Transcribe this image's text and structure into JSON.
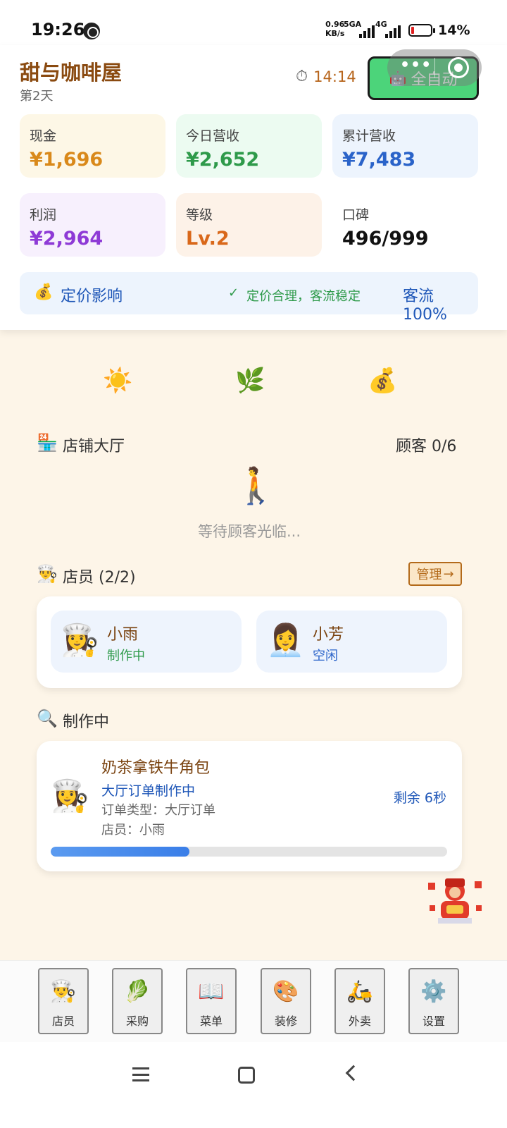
{
  "status_bar": {
    "time": "19:26",
    "speed_top": "0.96",
    "speed_bottom": "KB/s",
    "net1": "5GA",
    "net2": "4G",
    "battery": "14%"
  },
  "header": {
    "shop_name": "甜与咖啡屋",
    "day": "第2天",
    "timer": "14:14",
    "timer_icon": "stopwatch-icon",
    "auto_button": "全自动",
    "capsule_more": "•••"
  },
  "stats": [
    {
      "label": "现金",
      "value": "¥1,696",
      "bg": "#fdf7e6",
      "color": "#d9891a"
    },
    {
      "label": "今日营收",
      "value": "¥2,652",
      "bg": "#ecfbf1",
      "color": "#2e9a4a"
    },
    {
      "label": "累计营收",
      "value": "¥7,483",
      "bg": "#edf4fd",
      "color": "#2a63c9"
    },
    {
      "label": "利润",
      "value": "¥2,964",
      "bg": "#f7f0fd",
      "color": "#8e3ad6"
    },
    {
      "label": "等级",
      "value": "Lv.2",
      "bg": "#fdf2e8",
      "color": "#d9681a"
    },
    {
      "label": "口碑",
      "value": "496/999",
      "bg": "#ffffff",
      "color": "#111111"
    }
  ],
  "pricing": {
    "icon": "money-bag-icon",
    "title": "定价影响",
    "status": "定价合理，客流稳定",
    "flow": "客流 100%"
  },
  "weather": [
    "☀️",
    "🌿",
    "💰"
  ],
  "hall": {
    "title": "店铺大厅",
    "count": "顾客 0/6",
    "waiting": "等待顾客光临..."
  },
  "staff_section": {
    "title": "店员 (2/2)",
    "manage": "管理",
    "arrow": "→",
    "staff": [
      {
        "name": "小雨",
        "state": "制作中",
        "avatar": "👩‍🍳",
        "state_color": "#2e9a4a"
      },
      {
        "name": "小芳",
        "state": "空闲",
        "avatar": "👩‍💼",
        "state_color": "#2a63c9"
      }
    ]
  },
  "making": {
    "title": "制作中",
    "job": {
      "name": "奶茶拿铁牛角包",
      "sub": "大厅订单制作中",
      "type": "订单类型：大厅订单",
      "staff": "店员：小雨",
      "remain": "剩余 6秒",
      "progress": 0.35
    }
  },
  "bottom_nav": [
    {
      "icon": "👨‍🍳",
      "label": "店员"
    },
    {
      "icon": "🥬",
      "label": "采购"
    },
    {
      "icon": "📖",
      "label": "菜单"
    },
    {
      "icon": "🎨",
      "label": "装修"
    },
    {
      "icon": "🛵",
      "label": "外卖"
    },
    {
      "icon": "⚙️",
      "label": "设置"
    }
  ]
}
